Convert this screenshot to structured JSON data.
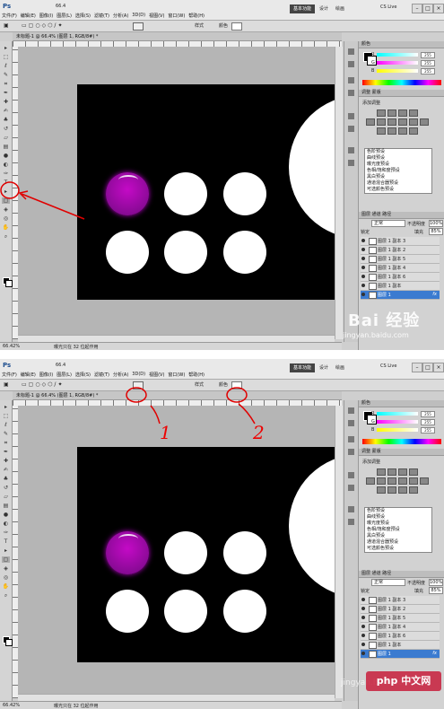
{
  "app": {
    "logo": "Ps",
    "zoom_menu": "66.4",
    "menu": [
      "文件(F)",
      "编辑(E)",
      "图像(I)",
      "图层(L)",
      "选择(S)",
      "滤镜(T)",
      "分析(A)",
      "3D(D)",
      "视图(V)",
      "窗口(W)",
      "帮助(H)"
    ],
    "workspaces": [
      "基本功能",
      "设计",
      "绘画"
    ],
    "cs_live": "CS Live"
  },
  "options_bar": {
    "style_label": "样式",
    "color_label": "颜色",
    "color_value": "#ffffff"
  },
  "document": {
    "tab_title": "未标题-1 @ 66.4% (图层 1, RGB/8#) *",
    "zoom_status": "66.42%",
    "status_text": "曝光只在 32 位起作用"
  },
  "color_panel": {
    "title": "颜色",
    "r_label": "R",
    "g_label": "G",
    "b_label": "B",
    "r": "255",
    "g": "255",
    "b": "255"
  },
  "adjustments_panel": {
    "tabs": [
      "调整",
      "蒙版"
    ],
    "title": "添加调整"
  },
  "presets": [
    "色阶预设",
    "曲线预设",
    "曝光度预设",
    "色相/饱和度预设",
    "黑白预设",
    "通道混合器预设",
    "可选颜色预设"
  ],
  "layers_panel": {
    "tabs": [
      "图层",
      "通道",
      "路径"
    ],
    "blend_mode": "正常",
    "opacity_label": "不透明度",
    "opacity": "100%",
    "lock_label": "锁定",
    "fill_label": "填充",
    "fill": "85%",
    "fx_label": "fx",
    "layers": [
      {
        "name": "图层 1 副本 3",
        "fx": false
      },
      {
        "name": "图层 1 副本 2",
        "fx": false
      },
      {
        "name": "图层 1 副本 5",
        "fx": false
      },
      {
        "name": "图层 1 副本 4",
        "fx": false
      },
      {
        "name": "图层 1 副本 6",
        "fx": false
      },
      {
        "name": "图层 1 副本",
        "fx": false
      },
      {
        "name": "图层 1",
        "fx": true,
        "active": true
      }
    ]
  },
  "annotations": {
    "label_1": "1",
    "label_2": "2",
    "arrow_color": "#e00000"
  },
  "watermarks": {
    "baidu_main": "Bai 经验",
    "baidu_url": "jingyan.baidu.com",
    "php_main": "php 中文网",
    "php_faint": "jingyan.baidu.com"
  }
}
